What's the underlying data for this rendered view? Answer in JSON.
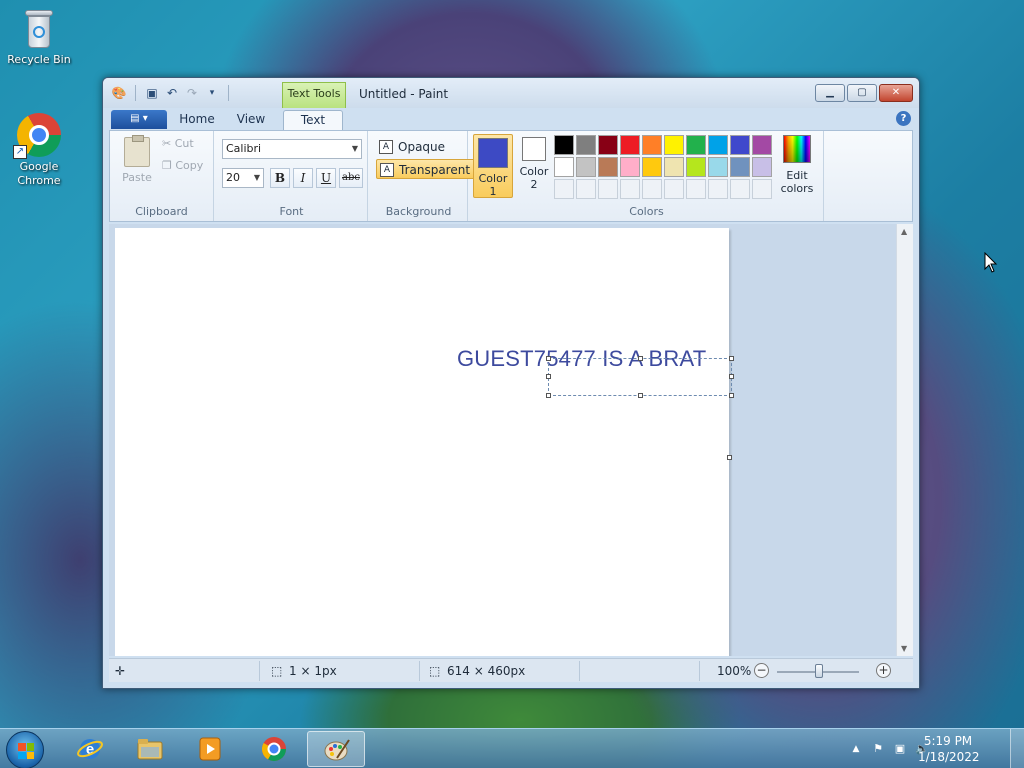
{
  "desktop": {
    "icons": [
      {
        "label": "Recycle Bin"
      },
      {
        "label": "Google Chrome"
      }
    ]
  },
  "window": {
    "title": "Untitled - Paint",
    "contextual_tab": "Text Tools",
    "tabs": [
      {
        "label": "Home"
      },
      {
        "label": "View"
      },
      {
        "label": "Text"
      }
    ],
    "active_tab": "Text"
  },
  "ribbon": {
    "clipboard": {
      "label": "Clipboard",
      "paste": "Paste",
      "cut": "Cut",
      "copy": "Copy"
    },
    "font": {
      "label": "Font",
      "family": "Calibri",
      "size": "20",
      "bold": "B",
      "italic": "I",
      "underline": "U",
      "strikethrough": "abc"
    },
    "background": {
      "label": "Background",
      "opaque": "Opaque",
      "transparent": "Transparent",
      "selected": "Transparent"
    },
    "colors": {
      "label": "Colors",
      "color1_label": "Color 1",
      "color2_label": "Color 2",
      "color1": "#3d4ac4",
      "color2": "#ffffff",
      "edit_label": "Edit colors",
      "palette_row1": [
        "#000000",
        "#7f7f7f",
        "#880015",
        "#ed1c24",
        "#ff7f27",
        "#fff200",
        "#22b14c",
        "#00a2e8",
        "#3f48cc",
        "#a349a4"
      ],
      "palette_row2": [
        "#ffffff",
        "#c3c3c3",
        "#b97a57",
        "#ffaec9",
        "#ffc90e",
        "#efe4b0",
        "#b5e61d",
        "#99d9ea",
        "#7092be",
        "#c8bfe7"
      ]
    }
  },
  "canvas": {
    "text": "GUEST75477 IS A BRAT",
    "text_color": "#3d4a9e"
  },
  "statusbar": {
    "selection_size": "1 × 1px",
    "canvas_size": "614 × 460px",
    "zoom": "100%"
  },
  "taskbar": {
    "time": "5:19 PM",
    "date": "1/18/2022"
  }
}
